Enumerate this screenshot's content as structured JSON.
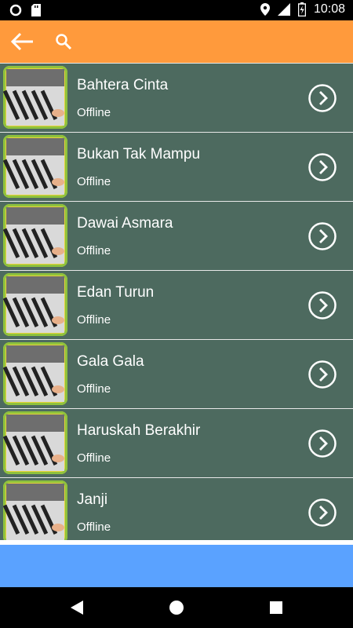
{
  "status_bar": {
    "time": "10:08",
    "icons": [
      "circle-notification-icon",
      "sd-card-icon",
      "location-icon",
      "signal-icon",
      "battery-charging-icon"
    ]
  },
  "app_bar": {
    "color": "#ff9a3c",
    "back_icon": "arrow-left-icon",
    "search_icon": "search-icon"
  },
  "songs": [
    {
      "title": "Bahtera Cinta",
      "status": "Offline"
    },
    {
      "title": "Bukan Tak Mampu",
      "status": "Offline"
    },
    {
      "title": "Dawai Asmara",
      "status": "Offline"
    },
    {
      "title": "Edan Turun",
      "status": "Offline"
    },
    {
      "title": "Gala Gala",
      "status": "Offline"
    },
    {
      "title": "Haruskah Berakhir",
      "status": "Offline"
    },
    {
      "title": "Janji",
      "status": "Offline"
    }
  ],
  "colors": {
    "row_bg": "#4d6a5f",
    "ad_bar": "#5aa2ff"
  },
  "nav_bar": {
    "buttons": [
      "back-triangle-icon",
      "home-circle-icon",
      "recents-square-icon"
    ]
  }
}
